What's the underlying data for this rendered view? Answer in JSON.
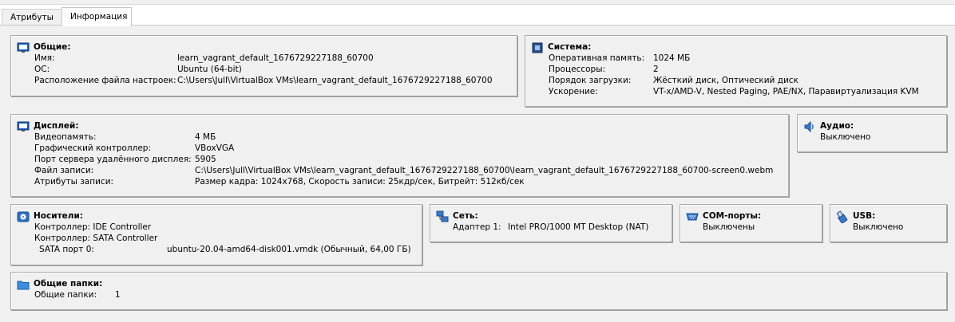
{
  "tabs": [
    {
      "label": "Атрибуты"
    },
    {
      "label": "Информация"
    }
  ],
  "general": {
    "title": "Общие:",
    "rows": [
      {
        "label": "Имя:",
        "value": "learn_vagrant_default_1676729227188_60700"
      },
      {
        "label": "ОС:",
        "value": "Ubuntu (64-bit)"
      },
      {
        "label": "Расположение файла настроек:",
        "value": "C:\\Users\\Jull\\VirtualBox VMs\\learn_vagrant_default_1676729227188_60700"
      }
    ]
  },
  "system": {
    "title": "Система:",
    "rows": [
      {
        "label": "Оперативная память:",
        "value": "1024 МБ"
      },
      {
        "label": "Процессоры:",
        "value": "2"
      },
      {
        "label": "Порядок загрузки:",
        "value": "Жёсткий диск, Оптический диск"
      },
      {
        "label": "Ускорение:",
        "value": "VT-x/AMD-V, Nested Paging, PAE/NX, Паравиртуализация KVM"
      }
    ]
  },
  "display": {
    "title": "Дисплей:",
    "rows": [
      {
        "label": "Видеопамять:",
        "value": "4 МБ"
      },
      {
        "label": "Графический контроллер:",
        "value": "VBoxVGA"
      },
      {
        "label": "Порт сервера удалённого дисплея:",
        "value": "5905"
      },
      {
        "label": "Файл записи:",
        "value": "C:\\Users\\Jull\\VirtualBox VMs\\learn_vagrant_default_1676729227188_60700\\learn_vagrant_default_1676729227188_60700-screen0.webm"
      },
      {
        "label": "Атрибуты записи:",
        "value": "Размер кадра: 1024x768, Скорость записи: 25кдр/сек, Битрейт: 512кб/сек"
      }
    ]
  },
  "audio": {
    "title": "Аудио:",
    "value": "Выключено"
  },
  "storage": {
    "title": "Носители:",
    "controller1": "Контроллер: IDE Controller",
    "controller2": "Контроллер: SATA Controller",
    "port_label": "SATA порт 0:",
    "port_value": "ubuntu-20.04-amd64-disk001.vmdk (Обычный, 64,00 ГБ)"
  },
  "network": {
    "title": "Сеть:",
    "adapter_label": "Адаптер 1:",
    "adapter_value": "Intel PRO/1000 MT Desktop (NAT)"
  },
  "com": {
    "title": "COM-порты:",
    "value": "Выключены"
  },
  "usb": {
    "title": "USB:",
    "value": "Выключено"
  },
  "shared": {
    "title": "Общие папки:",
    "label": "Общие папки:",
    "value": "1"
  }
}
